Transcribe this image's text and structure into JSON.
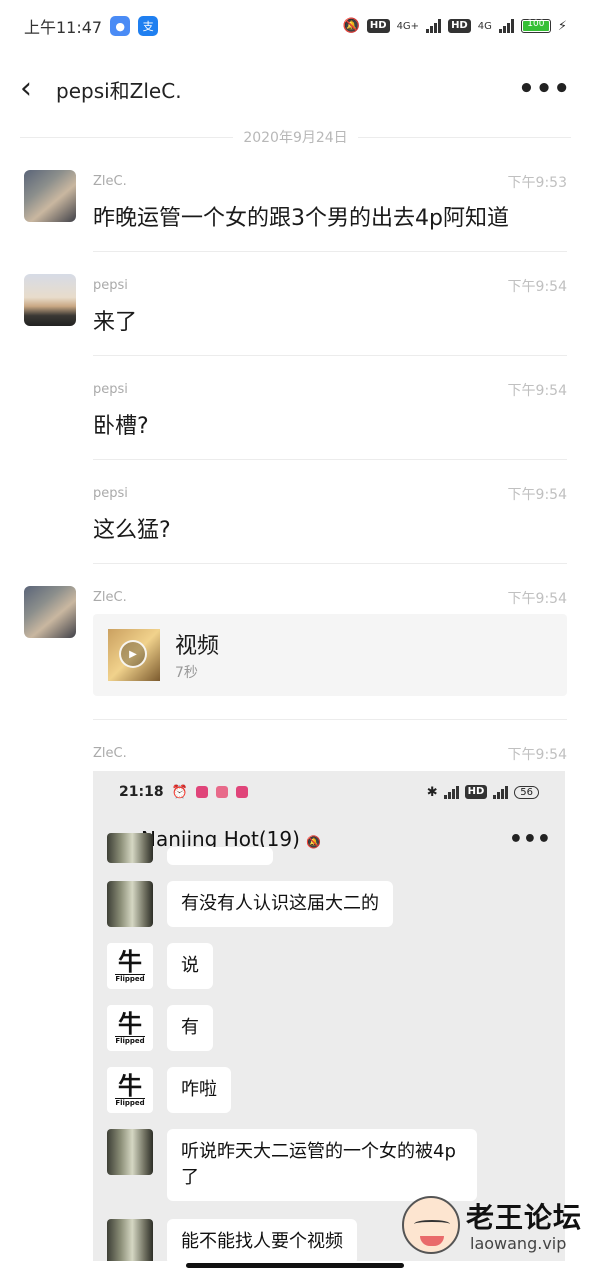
{
  "status_bar": {
    "time": "上午11:47",
    "battery": "100",
    "net1": "4G+",
    "net2": "4G",
    "hd": "HD"
  },
  "nav": {
    "back": "<",
    "title": "pepsi和ZleC.",
    "more": "•••"
  },
  "date_divider": "2020年9月24日",
  "messages": [
    {
      "sender": "ZleC.",
      "time": "下午9:53",
      "text": "昨晚运管一个女的跟3个男的出去4p阿知道"
    },
    {
      "sender": "pepsi",
      "time": "下午9:54",
      "text": "来了"
    },
    {
      "sender": "pepsi",
      "time": "下午9:54",
      "text": "卧槽?"
    },
    {
      "sender": "pepsi",
      "time": "下午9:54",
      "text": "这么猛?"
    },
    {
      "sender": "ZleC.",
      "time": "下午9:54",
      "video_title": "视频",
      "video_duration": "7秒"
    },
    {
      "sender": "ZleC.",
      "time": "下午9:54"
    }
  ],
  "screenshot": {
    "time": "21:18",
    "battery": "56",
    "title": "Nanjing Hot(19)",
    "more": "•••",
    "flip_word": "Flipped",
    "bubbles": [
      "有没有人认识这届大二的",
      "说",
      "有",
      "咋啦",
      "听说昨天大二运管的一个女的被4p了",
      "能不能找人要个视频"
    ]
  },
  "watermark": {
    "title": "老王论坛",
    "url": "laowang.vip"
  }
}
